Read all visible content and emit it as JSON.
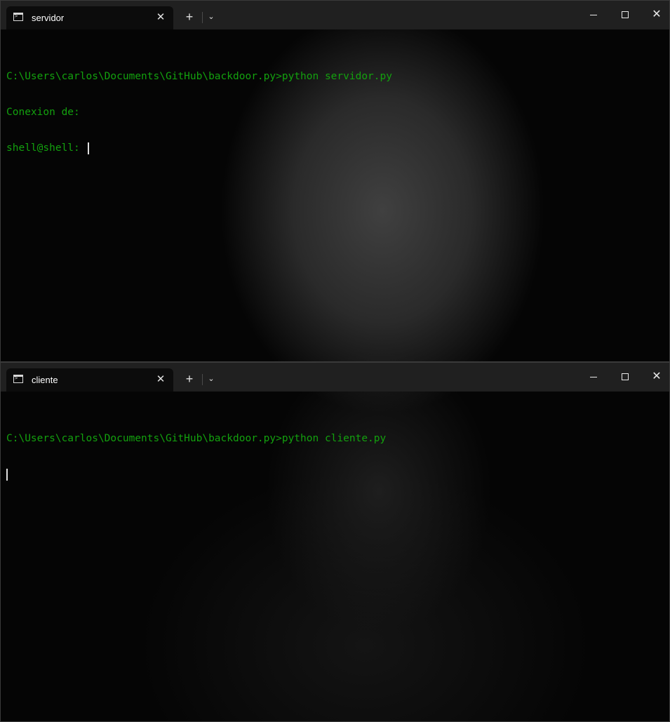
{
  "windows": [
    {
      "tab": {
        "title": "servidor",
        "icon": "terminal-icon",
        "close_label": "✕"
      },
      "new_tab_label": "+",
      "dropdown_label": "⌄",
      "controls": {
        "close_label": "✕"
      },
      "terminal": {
        "lines": [
          "C:\\Users\\carlos\\Documents\\GitHub\\backdoor.py>python servidor.py",
          "Conexion de:",
          "shell@shell: "
        ]
      }
    },
    {
      "tab": {
        "title": "cliente",
        "icon": "terminal-icon",
        "close_label": "✕"
      },
      "new_tab_label": "+",
      "dropdown_label": "⌄",
      "controls": {
        "close_label": "✕"
      },
      "terminal": {
        "lines": [
          "C:\\Users\\carlos\\Documents\\GitHub\\backdoor.py>python cliente.py"
        ]
      }
    }
  ],
  "colors": {
    "terminal_text": "#13a10e",
    "titlebar_bg": "#202020",
    "active_tab_bg": "#0c0c0c",
    "terminal_bg": "#0c0c0c"
  }
}
